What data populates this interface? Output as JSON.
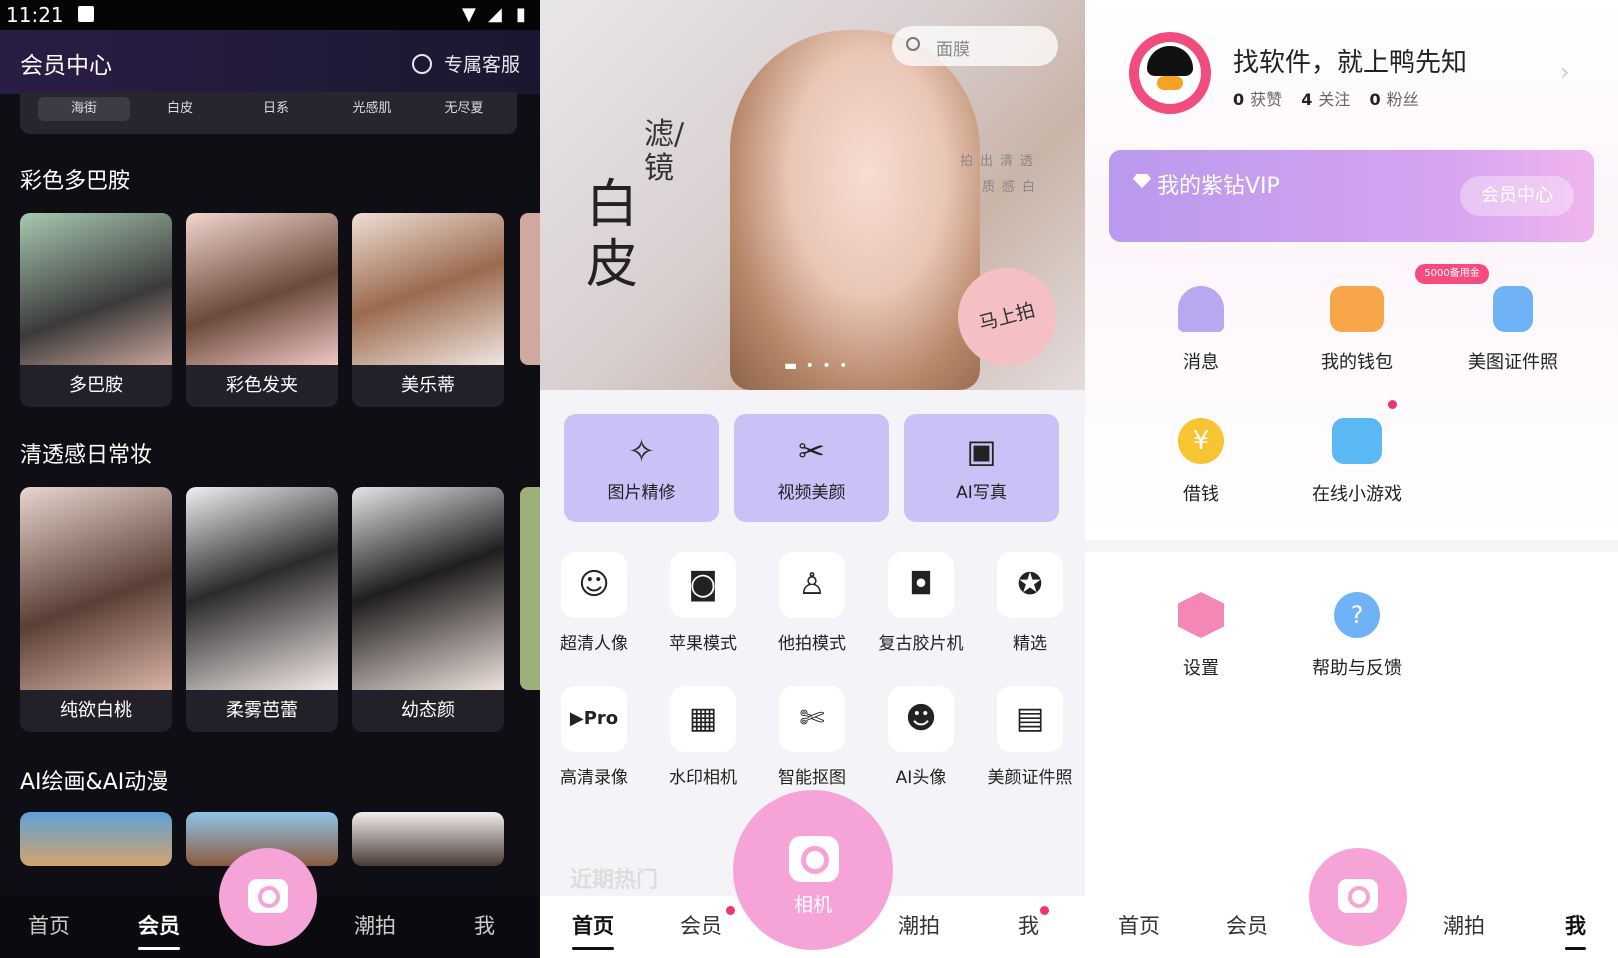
{
  "status": {
    "time": "11:21"
  },
  "member": {
    "title": "会员中心",
    "service": "专属客服",
    "subtabs": [
      "海街",
      "白皮",
      "日系",
      "光感肌",
      "无尽夏"
    ],
    "sections": [
      {
        "title": "彩色多巴胺",
        "cards": [
          "多巴胺",
          "彩色发夹",
          "美乐蒂"
        ]
      },
      {
        "title": "清透感日常妆",
        "cards": [
          "纯欲白桃",
          "柔雾芭蕾",
          "幼态颜"
        ]
      },
      {
        "title": "AI绘画&AI动漫"
      }
    ],
    "nav": [
      "首页",
      "会员",
      "潮拍",
      "我"
    ]
  },
  "home": {
    "search_placeholder": "面膜",
    "banner": {
      "big_text": "白皮",
      "vertical_text": "滤/镜",
      "tag1": "拍出清透",
      "tag2": "质感白",
      "shoot": "马上拍"
    },
    "big_buttons": [
      {
        "label": "图片精修",
        "icon": "magic-wand-icon"
      },
      {
        "label": "视频美颜",
        "icon": "scissors-icon"
      },
      {
        "label": "AI写真",
        "icon": "ai-photo-icon"
      }
    ],
    "tools_row1": [
      "超清人像",
      "苹果模式",
      "他拍模式",
      "复古胶片机",
      "精选"
    ],
    "tools_row2": [
      "高清录像",
      "水印相机",
      "智能抠图",
      "AI头像",
      "美颜证件照"
    ],
    "hot_title": "近期热门",
    "camera_label": "相机",
    "nav": [
      "首页",
      "会员",
      "潮拍",
      "我"
    ]
  },
  "me": {
    "username": "找软件，就上鸭先知",
    "stats": [
      {
        "num": "0",
        "label": "获赞"
      },
      {
        "num": "4",
        "label": "关注"
      },
      {
        "num": "0",
        "label": "粉丝"
      }
    ],
    "vip_title": "我的紫钻VIP",
    "vip_button": "会员中心",
    "badge": "5000备用金",
    "menu1": [
      "消息",
      "我的钱包",
      "美图证件照",
      "借钱",
      "在线小游戏"
    ],
    "menu2": [
      "设置",
      "帮助与反馈"
    ],
    "nav": [
      "首页",
      "会员",
      "潮拍",
      "我"
    ]
  }
}
